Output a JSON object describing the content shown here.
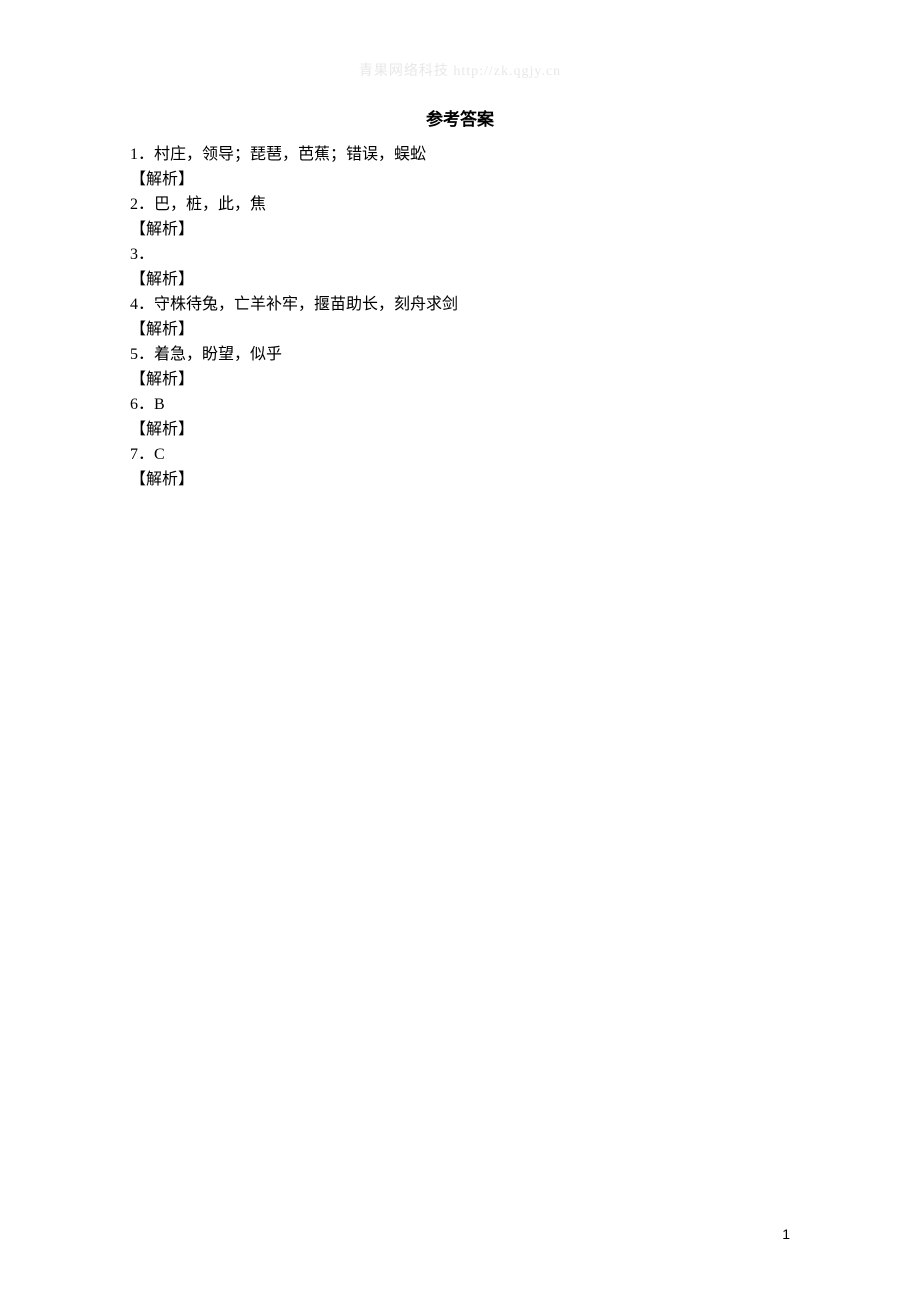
{
  "watermark": "青果网络科技 http://zk.qgjy.cn",
  "title": "参考答案",
  "lines": [
    "1．村庄，领导；琵琶，芭蕉；错误，蜈蚣",
    "【解析】",
    "2．巴，桩，此，焦",
    "【解析】",
    "3．",
    "【解析】",
    "4．守株待兔，亡羊补牢，揠苗助长，刻舟求剑",
    "【解析】",
    "5．着急，盼望，似乎",
    "【解析】",
    "6．B",
    "【解析】",
    "7．C",
    "【解析】"
  ],
  "page_number": "1"
}
